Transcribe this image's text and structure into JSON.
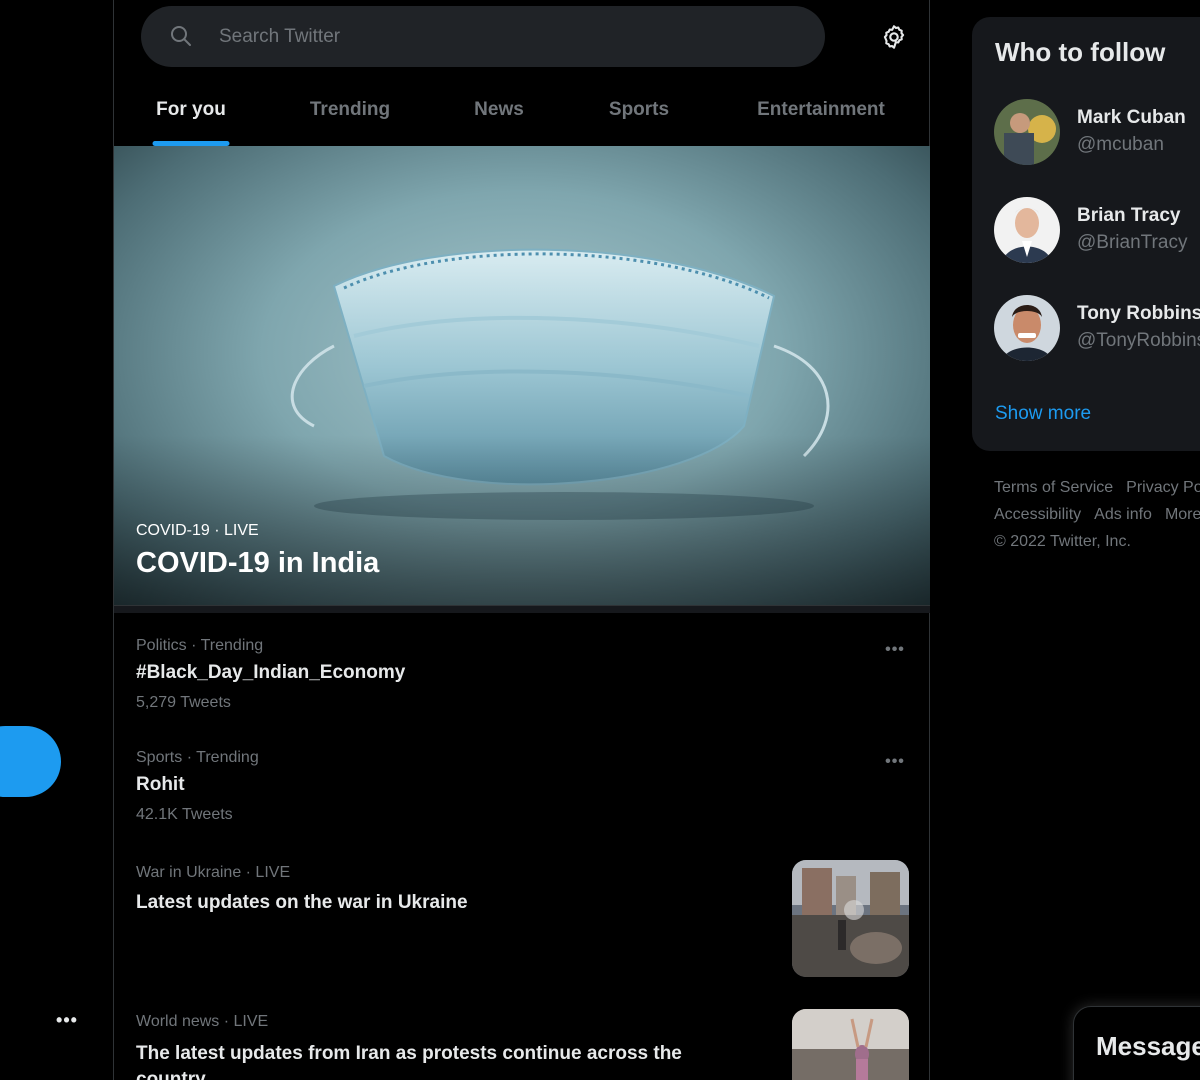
{
  "search": {
    "placeholder": "Search Twitter"
  },
  "tabs": [
    {
      "label": "For you",
      "active": true
    },
    {
      "label": "Trending"
    },
    {
      "label": "News"
    },
    {
      "label": "Sports"
    },
    {
      "label": "Entertainment"
    }
  ],
  "hero": {
    "kicker": "COVID-19 · LIVE",
    "title": "COVID-19 in India"
  },
  "trends": [
    {
      "meta": "Politics · Trending",
      "title": "#Black_Day_Indian_Economy",
      "count": "5,279 Tweets"
    },
    {
      "meta": "Sports · Trending",
      "title": "Rohit",
      "count": "42.1K Tweets"
    },
    {
      "meta": "War in Ukraine · LIVE",
      "title": "Latest updates on the war in Ukraine"
    },
    {
      "meta": "World news · LIVE",
      "title": "The latest updates from Iran as protests continue across the country"
    }
  ],
  "who_to_follow": {
    "title": "Who to follow",
    "people": [
      {
        "name": "Mark Cuban",
        "handle": "@mcuban"
      },
      {
        "name": "Brian Tracy",
        "handle": "@BrianTracy"
      },
      {
        "name": "Tony Robbins",
        "handle": "@TonyRobbins"
      }
    ],
    "show_more": "Show more"
  },
  "footer": {
    "links": [
      "Terms of Service",
      "Privacy Policy",
      "Accessibility",
      "Ads info",
      "More"
    ],
    "copyright": "© 2022 Twitter, Inc."
  },
  "messages": {
    "label": "Messages"
  },
  "colors": {
    "accent": "#1d9bf0",
    "background": "#000000",
    "card": "#16181c",
    "muted": "#71767b"
  },
  "icons": [
    "search-icon",
    "settings-gear-icon",
    "more-dots-icon",
    "verified-badge-icon"
  ]
}
